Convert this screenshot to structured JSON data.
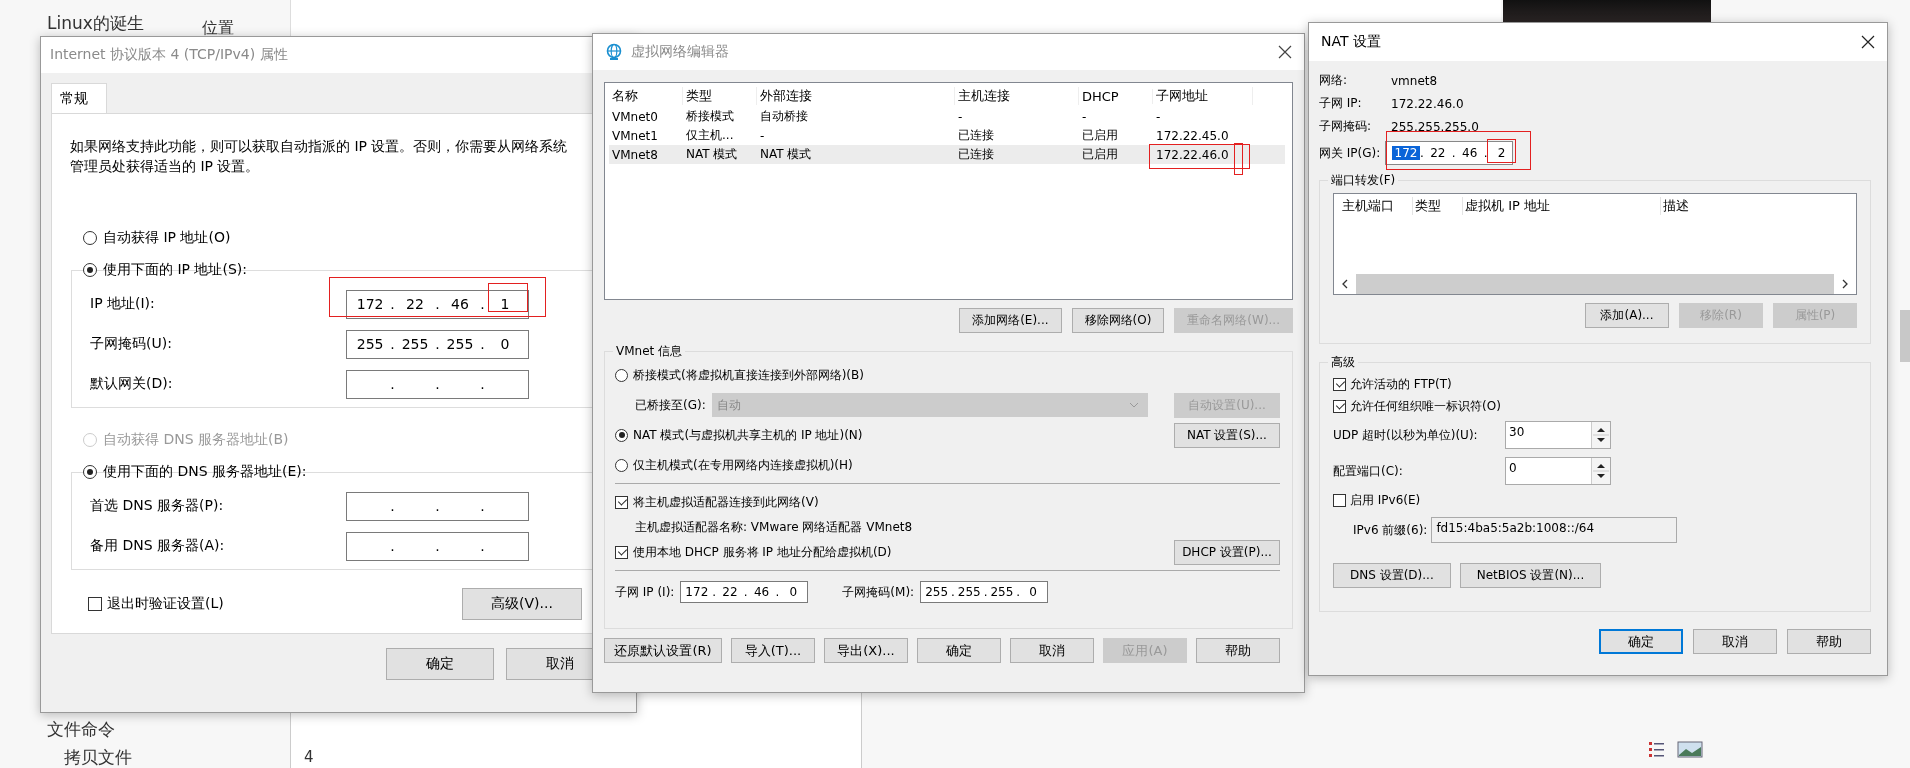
{
  "background": {
    "ribbon_label": "位置",
    "sidebar_items": [
      "Linux的诞生",
      "文件命令",
      "拷贝文件"
    ],
    "page_number": "4"
  },
  "ipv4_dialog": {
    "title": "Internet 协议版本 4 (TCP/IPv4) 属性",
    "tabs": [
      {
        "label": "常规",
        "selected": true
      }
    ],
    "description": "如果网络支持此功能，则可以获取自动指派的 IP 设置。否则，你需要从网络系统管理员处获得适当的 IP 设置。",
    "separator": ".",
    "ip_options": [
      {
        "label": "自动获得 IP 地址(O)",
        "selected": false,
        "disabled": false
      },
      {
        "label": "使用下面的 IP 地址(S):",
        "selected": true,
        "disabled": false
      }
    ],
    "ip_fields": [
      {
        "label": "IP 地址(I):",
        "octets": [
          "172",
          "22",
          "46",
          "1"
        ]
      },
      {
        "label": "子网掩码(U):",
        "octets": [
          "255",
          "255",
          "255",
          "0"
        ]
      },
      {
        "label": "默认网关(D):"
      }
    ],
    "dns_options": [
      {
        "label": "自动获得 DNS 服务器地址(B)",
        "selected": false,
        "disabled": true
      },
      {
        "label": "使用下面的 DNS 服务器地址(E):",
        "selected": true,
        "disabled": false
      }
    ],
    "dns_fields": [
      {
        "label": "首选 DNS 服务器(P):"
      },
      {
        "label": "备用 DNS 服务器(A):"
      }
    ],
    "validate": {
      "label": "退出时验证设置(L)",
      "checked": false
    },
    "advanced_button": "高级(V)...",
    "buttons": [
      "确定",
      "取消"
    ]
  },
  "vnet_editor": {
    "title": "虚拟网络编辑器",
    "columns": [
      "名称",
      "类型",
      "外部连接",
      "主机连接",
      "DHCP",
      "子网地址"
    ],
    "rows": [
      {
        "cells": [
          "VMnet0",
          "桥接模式",
          "自动桥接",
          "-",
          "-",
          "-"
        ],
        "selected": false
      },
      {
        "cells": [
          "VMnet1",
          "仅主机...",
          "-",
          "已连接",
          "已启用",
          "172.22.45.0"
        ],
        "selected": false
      },
      {
        "cells": [
          "VMnet8",
          "NAT 模式",
          "NAT 模式",
          "已连接",
          "已启用",
          "172.22.46.0"
        ],
        "selected": true
      }
    ],
    "list_buttons": [
      {
        "label": "添加网络(E)...",
        "disabled": false
      },
      {
        "label": "移除网络(O)",
        "disabled": false
      },
      {
        "label": "重命名网络(W)...",
        "disabled": true
      }
    ],
    "group_title": "VMnet 信息",
    "bridged_option": {
      "label": "桥接模式(将虚拟机直接连接到外部网络)(B)",
      "selected": false
    },
    "bridged_to": {
      "label": "已桥接至(G):",
      "value": "自动",
      "disabled": true,
      "button": {
        "label": "自动设置(U)...",
        "disabled": true
      }
    },
    "nat_option": {
      "label": "NAT 模式(与虚拟机共享主机的 IP 地址)(N)",
      "selected": true,
      "button": {
        "label": "NAT 设置(S)...",
        "disabled": false
      }
    },
    "host_option": {
      "label": "仅主机模式(在专用网络内连接虚拟机)(H)",
      "selected": false
    },
    "connect_adapter": {
      "label": "将主机虚拟适配器连接到此网络(V)",
      "checked": true
    },
    "adapter_name": "主机虚拟适配器名称: VMware 网络适配器 VMnet8",
    "use_dhcp": {
      "label": "使用本地 DHCP 服务将 IP 地址分配给虚拟机(D)",
      "checked": true,
      "button": {
        "label": "DHCP 设置(P)...",
        "disabled": false
      }
    },
    "separator": ".",
    "subnet_ip": {
      "label": "子网 IP (I):",
      "octets": [
        "172",
        "22",
        "46",
        "0"
      ]
    },
    "subnet_mask": {
      "label": "子网掩码(M):",
      "octets": [
        "255",
        "255",
        "255",
        "0"
      ]
    },
    "buttons": [
      {
        "label": "还原默认设置(R)",
        "disabled": false
      },
      {
        "label": "导入(T)...",
        "disabled": false
      },
      {
        "label": "导出(X)...",
        "disabled": false
      },
      {
        "label": "确定",
        "disabled": false
      },
      {
        "label": "取消",
        "disabled": false
      },
      {
        "label": "应用(A)",
        "disabled": true
      },
      {
        "label": "帮助",
        "disabled": false
      }
    ]
  },
  "nat_dialog": {
    "title": "NAT 设置",
    "info": [
      {
        "label": "网络:",
        "value": "vmnet8"
      },
      {
        "label": "子网 IP:",
        "value": "172.22.46.0"
      },
      {
        "label": "子网掩码:",
        "value": "255.255.255.0"
      }
    ],
    "gateway": {
      "label": "网关 IP(G):",
      "separator": ".",
      "octets": [
        {
          "text": "172",
          "selected": true
        },
        {
          "text": "22",
          "selected": false
        },
        {
          "text": "46",
          "selected": false
        },
        {
          "text": "2",
          "selected": false
        }
      ]
    },
    "port_forwarding": {
      "title": "端口转发(F)",
      "columns": [
        "主机端口",
        "类型",
        "虚拟机 IP 地址",
        "描述"
      ],
      "buttons": [
        {
          "label": "添加(A)...",
          "disabled": false
        },
        {
          "label": "移除(R)",
          "disabled": true
        },
        {
          "label": "属性(P)",
          "disabled": true
        }
      ]
    },
    "advanced": {
      "title": "高级",
      "checkboxes": [
        {
          "label": "允许活动的 FTP(T)",
          "checked": true
        },
        {
          "label": "允许任何组织唯一标识符(O)",
          "checked": true
        }
      ],
      "spinners": [
        {
          "label": "UDP 超时(以秒为单位)(U):",
          "value": "30"
        },
        {
          "label": "配置端口(C):",
          "value": "0"
        }
      ],
      "ipv6": {
        "label": "启用 IPv6(E)",
        "checked": false
      },
      "prefix": {
        "label": "IPv6 前缀(6):",
        "value": "fd15:4ba5:5a2b:1008::/64",
        "disabled": true
      },
      "buttons": [
        "DNS 设置(D)...",
        "NetBIOS 设置(N)..."
      ]
    },
    "buttons": [
      {
        "label": "确定",
        "default": true
      },
      {
        "label": "取消",
        "default": false
      },
      {
        "label": "帮助",
        "default": false
      }
    ]
  }
}
